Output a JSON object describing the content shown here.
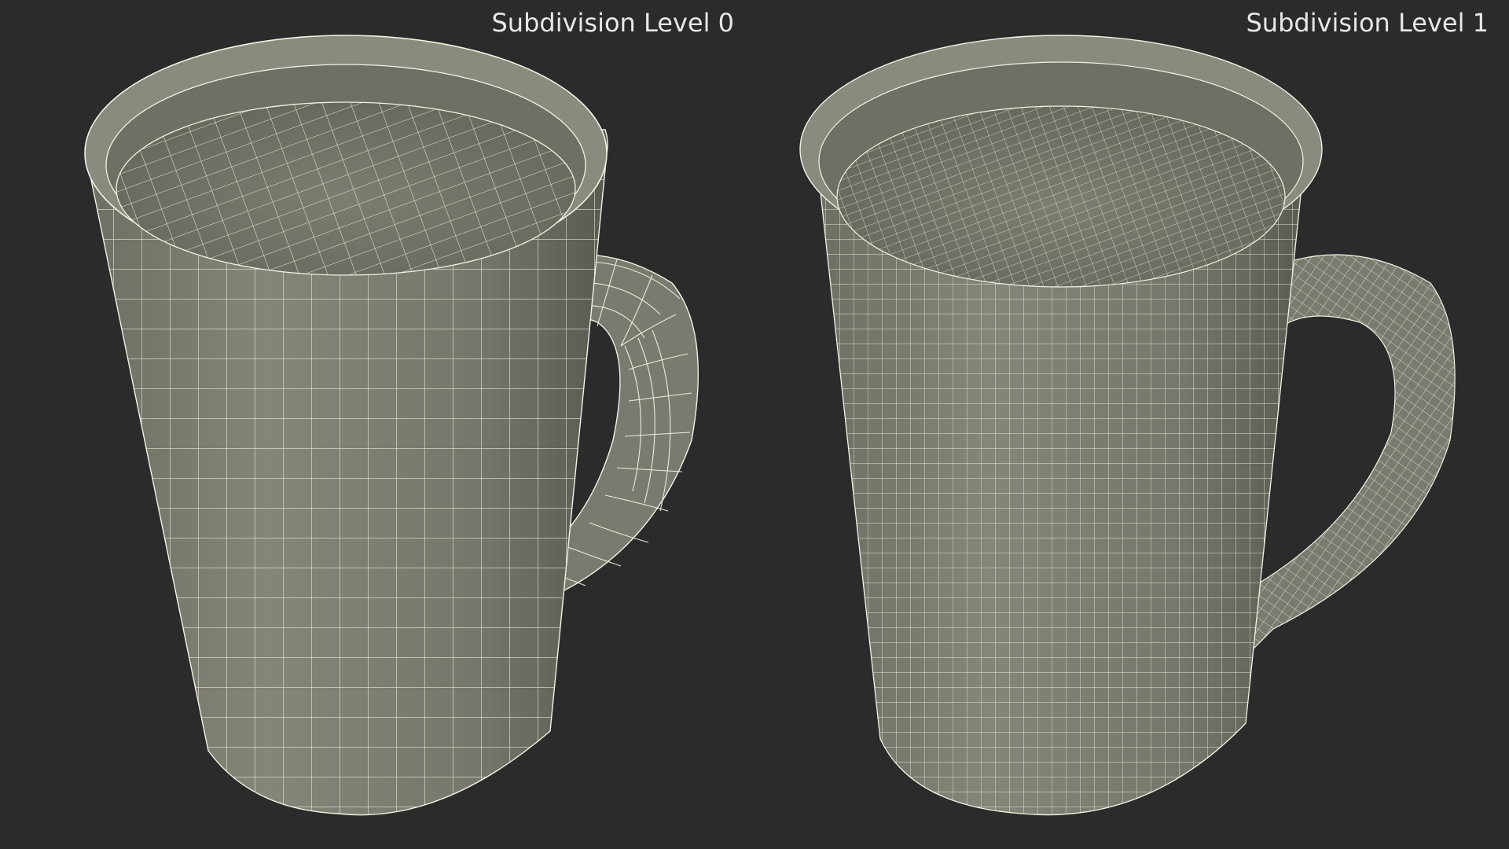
{
  "panels": [
    {
      "label": "Subdivision Level 0",
      "wire_density": "low"
    },
    {
      "label": "Subdivision Level 1",
      "wire_density": "high"
    }
  ],
  "colors": {
    "background": "#2b2b2b",
    "mug_body": "#7d7d72",
    "mug_shadow": "#5e5e55",
    "wire": "#f4f2e2",
    "label": "#e8e8e8"
  }
}
